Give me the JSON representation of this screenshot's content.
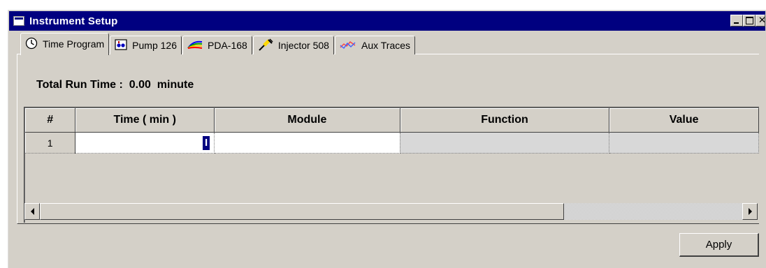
{
  "window": {
    "title": "Instrument Setup"
  },
  "tabs": [
    {
      "label": "Time Program",
      "icon": "clock-icon",
      "active": true
    },
    {
      "label": "Pump 126",
      "icon": "pump-icon",
      "active": false
    },
    {
      "label": "PDA-168",
      "icon": "rainbow-spectrum-icon",
      "active": false
    },
    {
      "label": "Injector 508",
      "icon": "syringe-icon",
      "active": false
    },
    {
      "label": "Aux Traces",
      "icon": "traces-icon",
      "active": false
    }
  ],
  "run_time": {
    "label": "Total Run Time :",
    "value": "0.00",
    "unit": "minute"
  },
  "grid": {
    "columns": [
      "#",
      "Time ( min )",
      "Module",
      "Function",
      "Value"
    ],
    "rows": [
      {
        "num": "1",
        "time": "",
        "module": "",
        "function": "",
        "value": ""
      }
    ]
  },
  "buttons": {
    "apply": "Apply"
  }
}
